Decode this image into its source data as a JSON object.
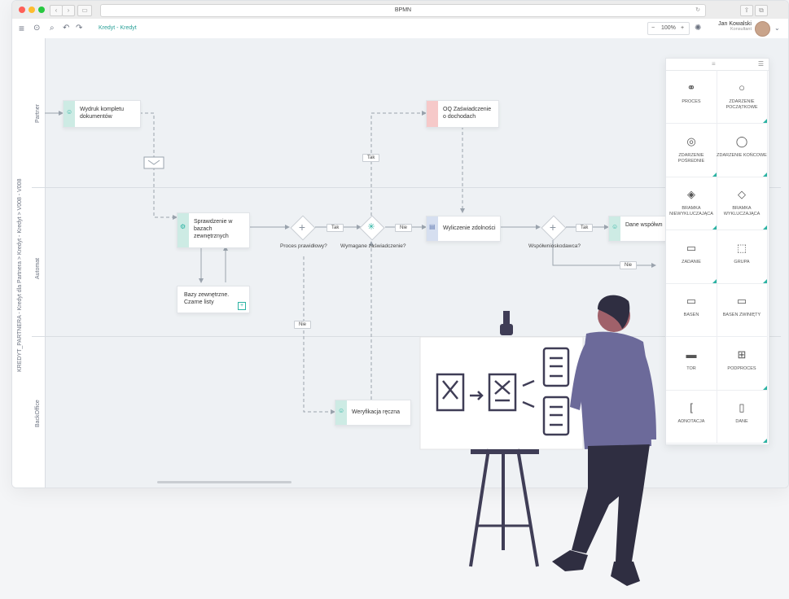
{
  "window": {
    "url": "BPMN"
  },
  "toolbar": {
    "breadcrumb": "Kredyt - Kredyt",
    "zoom": "100%",
    "zoom_minus": "−",
    "zoom_plus": "+",
    "user_name": "Jan Kowalski",
    "user_role": "Konsultant"
  },
  "pool": {
    "label": "KREDYT_PARTNERA - Kredyt dla Partnera  >  Kredyt - Kredyt  >  V008 - V008"
  },
  "lanes": [
    "Partner",
    "Automat",
    "BackOffice"
  ],
  "tasks": {
    "t1": "Wydruk kompletu dokumentów",
    "t2": "OQ Zaświadczenie o dochodach",
    "t3": "Sprawdzenie w bazach zewnętrznych",
    "t4": "Wyliczenie zdolności",
    "t5": "Dane współwnioskodawcy",
    "t6": "Bazy zewnętrzne. Czarne listy",
    "t7": "Weryfikacja ręczna"
  },
  "gateways": {
    "g1": "Proces prawidłowy?",
    "g2": "Wymagane zaświadczenie?",
    "g3": "Współwnioskodawca?"
  },
  "flow_labels": {
    "tak1": "Tak",
    "tak2": "Tak",
    "tak3": "Tak",
    "nie1": "Nie",
    "nie2": "Nie",
    "nie3": "Nie"
  },
  "palette": {
    "items": [
      {
        "label": "PROCES",
        "icon": "process-icon"
      },
      {
        "label": "ZDARZENIE POCZĄTKOWE",
        "icon": "start-event-icon"
      },
      {
        "label": "ZDARZENIE POŚREDNIE",
        "icon": "intermediate-event-icon"
      },
      {
        "label": "ZDARZENIE KOŃCOWE",
        "icon": "end-event-icon"
      },
      {
        "label": "BRAMKA NIEWYKLUCZAJĄCA",
        "icon": "inclusive-gateway-icon"
      },
      {
        "label": "BRAMKA WYKLUCZAJĄCA",
        "icon": "exclusive-gateway-icon"
      },
      {
        "label": "ZADANIE",
        "icon": "task-icon"
      },
      {
        "label": "GRUPA",
        "icon": "group-icon"
      },
      {
        "label": "BASEN",
        "icon": "pool-icon"
      },
      {
        "label": "BASEN ZWINIĘTY",
        "icon": "collapsed-pool-icon"
      },
      {
        "label": "TOR",
        "icon": "lane-icon"
      },
      {
        "label": "PODPROCES",
        "icon": "subprocess-icon"
      },
      {
        "label": "ADNOTACJA",
        "icon": "annotation-icon"
      },
      {
        "label": "DANE",
        "icon": "data-icon"
      }
    ]
  },
  "colors": {
    "accent": "#2bb3a3",
    "task_green": "#cdebe4",
    "task_red": "#f6c9c9",
    "task_blue": "#d6dff0",
    "illus_purple": "#6c6a9a",
    "illus_dark": "#2f2e41"
  }
}
